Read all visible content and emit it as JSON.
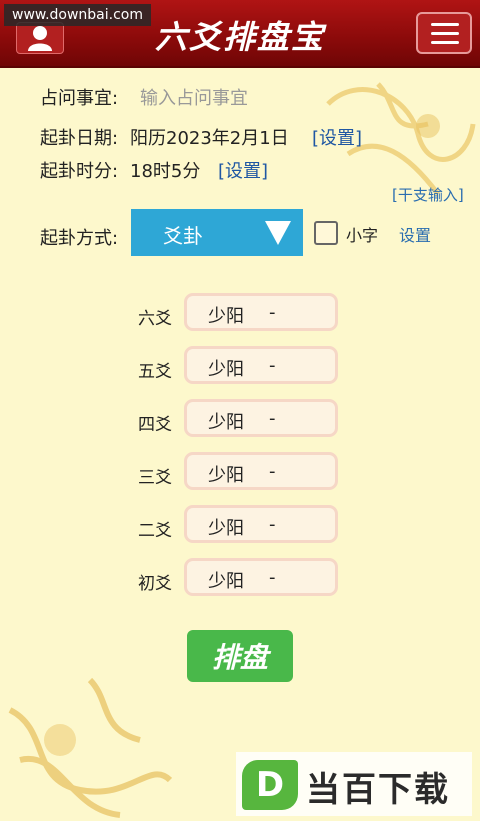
{
  "watermark": "www.downbai.com",
  "header": {
    "title": "六爻排盘宝"
  },
  "form": {
    "question_label": "占问事宜:",
    "question_placeholder": "输入占问事宜",
    "date_label": "起卦日期:",
    "date_value": "阳历2023年2月1日",
    "date_set": "[设置]",
    "time_label": "起卦时分:",
    "time_value": "18时5分",
    "time_set": "[设置]",
    "ganzhi_link": "[干支输入]",
    "method_label": "起卦方式:",
    "method_selected": "爻卦",
    "small_font_label": "小字",
    "settings_link": "设置"
  },
  "yaos": [
    {
      "label": "六爻",
      "value": "少阳",
      "mark": "-"
    },
    {
      "label": "五爻",
      "value": "少阳",
      "mark": "-"
    },
    {
      "label": "四爻",
      "value": "少阳",
      "mark": "-"
    },
    {
      "label": "三爻",
      "value": "少阳",
      "mark": "-"
    },
    {
      "label": "二爻",
      "value": "少阳",
      "mark": "-"
    },
    {
      "label": "初爻",
      "value": "少阳",
      "mark": "-"
    }
  ],
  "submit_label": "排盘",
  "brand": {
    "badge": "D",
    "name": "当百下载"
  },
  "colors": {
    "header": "#9c0e0e",
    "background": "#fdf8cc",
    "select": "#2ea7d6",
    "button": "#49b84a",
    "link": "#1f57a3"
  }
}
